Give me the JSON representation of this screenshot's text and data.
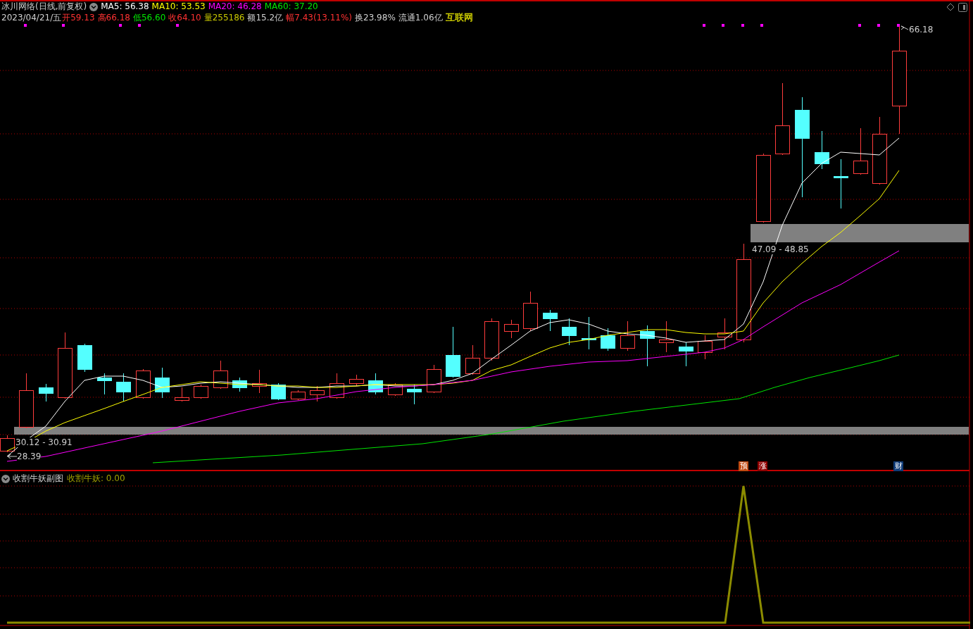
{
  "header": {
    "title": "冰川网络(日线,前复权)",
    "ma": [
      {
        "label": "MA5: 56.38",
        "color": "#ffffff"
      },
      {
        "label": "MA10: 53.53",
        "color": "#ffff00"
      },
      {
        "label": "MA20: 46.28",
        "color": "#ff00ff"
      },
      {
        "label": "MA60: 37.20",
        "color": "#00e600"
      }
    ]
  },
  "quote": {
    "date": "2023/04/21/五",
    "fields": [
      {
        "text": "开59.13",
        "color": "#ff3232"
      },
      {
        "text": "高66.18",
        "color": "#ff3232"
      },
      {
        "text": "低56.60",
        "color": "#00e600"
      },
      {
        "text": "收64.10",
        "color": "#ff3232"
      },
      {
        "text": "量255186",
        "color": "#c8c800"
      },
      {
        "text": "额15.2亿",
        "color": "#d0d0d0"
      },
      {
        "text": "幅7.43(13.11%)",
        "color": "#ff3232"
      },
      {
        "text": "换23.98%",
        "color": "#d0d0d0"
      },
      {
        "text": "流通1.06亿",
        "color": "#d0d0d0"
      },
      {
        "text": "互联网",
        "color": "#c8c800"
      }
    ]
  },
  "chart_labels": [
    "66.18",
    "47.09 - 48.85",
    "30.12 - 30.91",
    "28.39"
  ],
  "badges": [
    {
      "text": "预",
      "color": "#c04a10"
    },
    {
      "text": "涨",
      "color": "#900000"
    },
    {
      "text": "财",
      "color": "#103c78"
    }
  ],
  "subchart": {
    "title": "收割牛妖副图",
    "indicator": "收割牛妖: 0.00"
  }
}
